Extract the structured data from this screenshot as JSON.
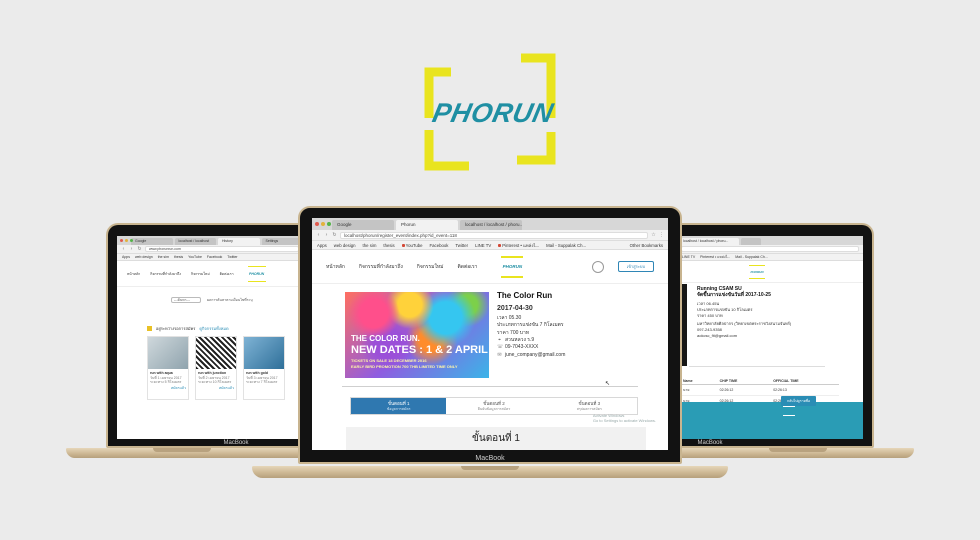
{
  "logo": {
    "word": "PHORUN",
    "frame_color": "#e9e41f",
    "text_color": "#1f8fa3"
  },
  "laptop_brand": "MacBook",
  "center": {
    "tabs": [
      "Google",
      "Phorun",
      "localhost / localhost / phoru..."
    ],
    "url": "localhost/phorun/register_event/index.php?id_event=118",
    "bookmarks": [
      "Apps",
      "web design",
      "the sim",
      "thesis",
      "YouTube",
      "Facebook",
      "Twitter",
      "LINE TV",
      "Pinterest • แหล่งไ...",
      "Mail - Suppalak Ch...",
      "Other Bookmarks"
    ],
    "nav": [
      "หน้าหลัก",
      "กิจกรรมที่กำลังมาถึง",
      "กิจกรรมใหม่",
      "ติดต่อเรา"
    ],
    "login_label": "เข้าสู่ระบบ",
    "poster": {
      "line1": "THE COLOR RUN.",
      "line2": "NEW DATES : 1 & 2 APRIL 2017",
      "line3": "TICKETS ON SALE 18 DECEMBER 2016",
      "line4": "EARLY BIRD PROMOTION 700 THB LIMITED TIME ONLY"
    },
    "event": {
      "title": "The Color Run",
      "date": "2017-04-30",
      "time": "เวลา 05.30",
      "category": "ประเภทการแข่งขัน 7 กิโลเมตร",
      "price": "ราคา 700 บาท",
      "location": "สวนหลวง ร.9",
      "phone": "09-7043-XXXX",
      "email": "june_company@gmail.com"
    },
    "steps": [
      {
        "label": "ขั้นตอนที่ 1",
        "sub": "ข้อมูลการสมัคร"
      },
      {
        "label": "ขั้นตอนที่ 2",
        "sub": "ยืนยันข้อมูลการสมัคร"
      },
      {
        "label": "ขั้นตอนที่ 3",
        "sub": "สรุปผลการสมัคร"
      }
    ],
    "step_heading": "ขั้นตอนที่ 1",
    "watermark_1": "Activate Windows",
    "watermark_2": "Go to Settings to activate Windows."
  },
  "left": {
    "tabs": [
      "Google",
      "localhost / localhost",
      "History",
      "Settings"
    ],
    "url": "www.phorunrun.com",
    "bookmarks": [
      "Apps",
      "web design",
      "the sim",
      "thesis",
      "YouTube",
      "Facebook",
      "Twitter",
      "LINE TV",
      "Pinterest"
    ],
    "nav": [
      "หน้าหลัก",
      "กิจกรรมที่กำลังมาถึง",
      "กิจกรรมใหม่",
      "ติดต่อเรา"
    ],
    "filter": "---ค้นหา---",
    "filter_hint": "ผลการค้นหาตามเงื่อนไขที่ระบุ",
    "section": "อยู่ระหว่างรอการสมัคร",
    "section_link": "ดูกิจกรรมทั้งหมด",
    "cards": [
      {
        "title": "run with aqua",
        "date": "วันที่ 1 เมษายน 2017",
        "type": "ระยะทาง 5 กิโลเมตร",
        "status": "สมัครแล้ว"
      },
      {
        "title": "run with junction",
        "date": "วันที่ 2 เมษายน 2017",
        "type": "ระยะทาง 10 กิโลเมตร",
        "status": "สมัครแล้ว"
      },
      {
        "title": "run with gold",
        "date": "วันที่ 3 เมษายน 2017",
        "type": "ระยะทาง 7 กิโลเมตร",
        "status": ""
      }
    ]
  },
  "right": {
    "tabs": [
      "localhost / localhost / phoru...",
      ""
    ],
    "bookmarks": [
      "LINE TV",
      "Pinterest • แหล่งไ...",
      "Mail - Suppalak Ch..."
    ],
    "event_title": "Running CSAM SU",
    "event_date": "จัดขึ้นการแข่งขันวันที่ 2017-10-25",
    "time": "เวลา 06.45น",
    "category": "ประเภทการแข่งขัน 10 กิโลเมตร",
    "price": "ราคา 450 บาท",
    "location": "มหาวิทยาลัยศิลปากร (วิทยาเขตพระราชวังสนามจันทร์)",
    "phone": "097-243-9358",
    "email": "aokcsc_fit@gmail.com",
    "table_headers": [
      "Name",
      "CHIP TIME",
      "OFFICIAL TIME"
    ],
    "table_rows": [
      [
        "นาย",
        "02:26:12",
        "02:26:13"
      ],
      [
        "นาย",
        "02:26:12",
        "02:26:13"
      ],
      [
        "นาย",
        "02:26:12",
        "02:26:13"
      ]
    ],
    "button": "กลับไปดูรายชื่อ"
  }
}
